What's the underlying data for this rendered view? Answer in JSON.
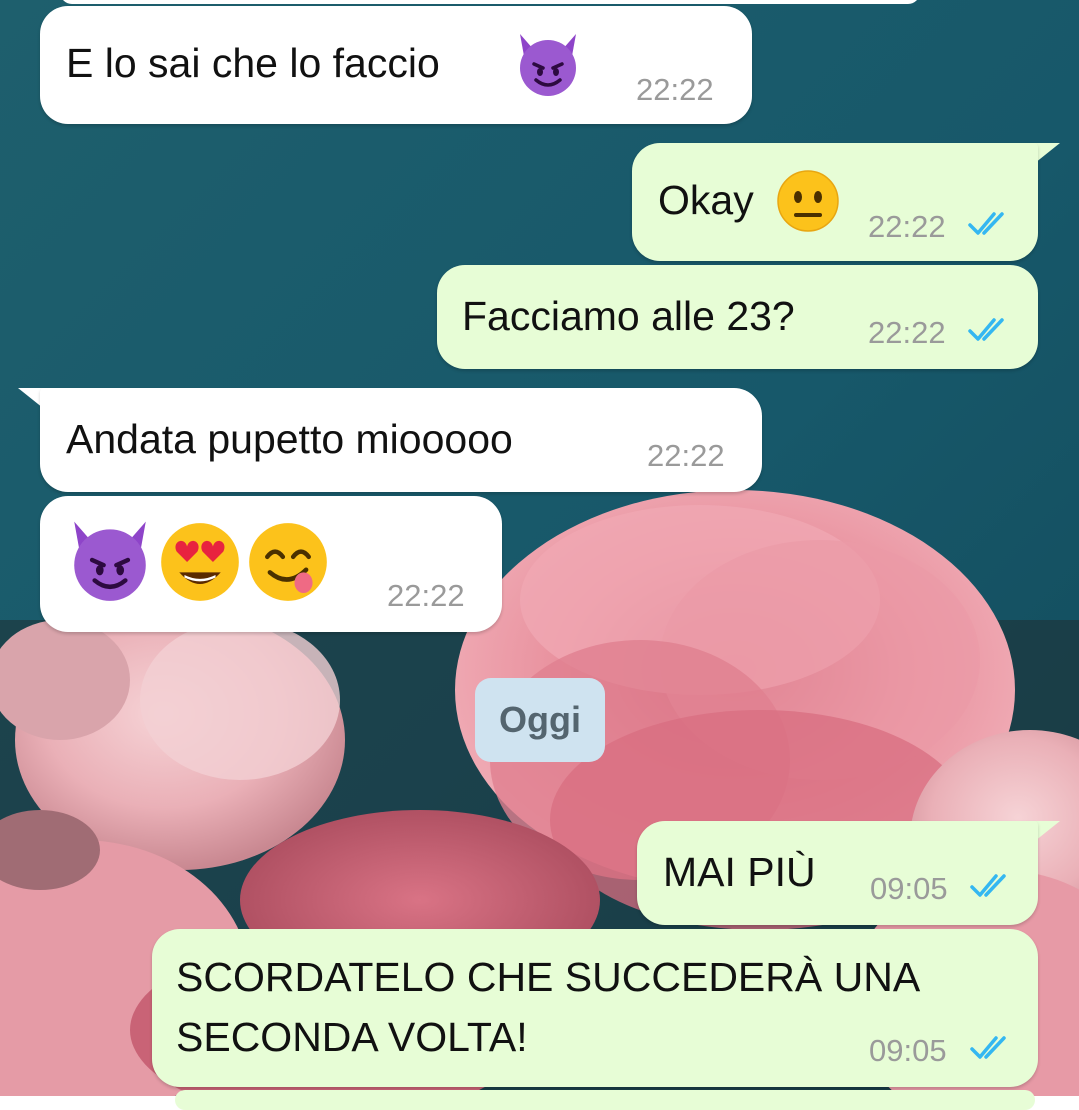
{
  "chat": {
    "date_separator": "Oggi",
    "messages": [
      {
        "direction": "incoming",
        "text": "E lo sai che lo faccio",
        "emojis": [
          "smiling-face-with-horns"
        ],
        "time": "22:22"
      },
      {
        "direction": "outgoing",
        "text": "Okay",
        "emojis": [
          "neutral-face"
        ],
        "time": "22:22",
        "status": "read"
      },
      {
        "direction": "outgoing",
        "text": "Facciamo alle 23?",
        "time": "22:22",
        "status": "read"
      },
      {
        "direction": "incoming",
        "text": "Andata pupetto miooooo",
        "time": "22:22"
      },
      {
        "direction": "incoming",
        "text": "",
        "emojis": [
          "smiling-face-with-horns",
          "smiling-face-with-heart-eyes",
          "face-savoring-food"
        ],
        "time": "22:22"
      },
      {
        "direction": "outgoing",
        "text": "MAI PIÙ",
        "time": "09:05",
        "status": "read"
      },
      {
        "direction": "outgoing",
        "text": "SCORDATELO CHE SUCCEDERÀ UNA SECONDA VOLTA!",
        "time": "09:05",
        "status": "read"
      }
    ]
  },
  "colors": {
    "incoming_bubble": "#ffffff",
    "outgoing_bubble": "#e7fdd6",
    "read_ticks": "#34b7f1",
    "date_chip": "#cfe3f0",
    "wallpaper_teal": "#1d5d6b",
    "wallpaper_flowers": "#e98e9c"
  }
}
